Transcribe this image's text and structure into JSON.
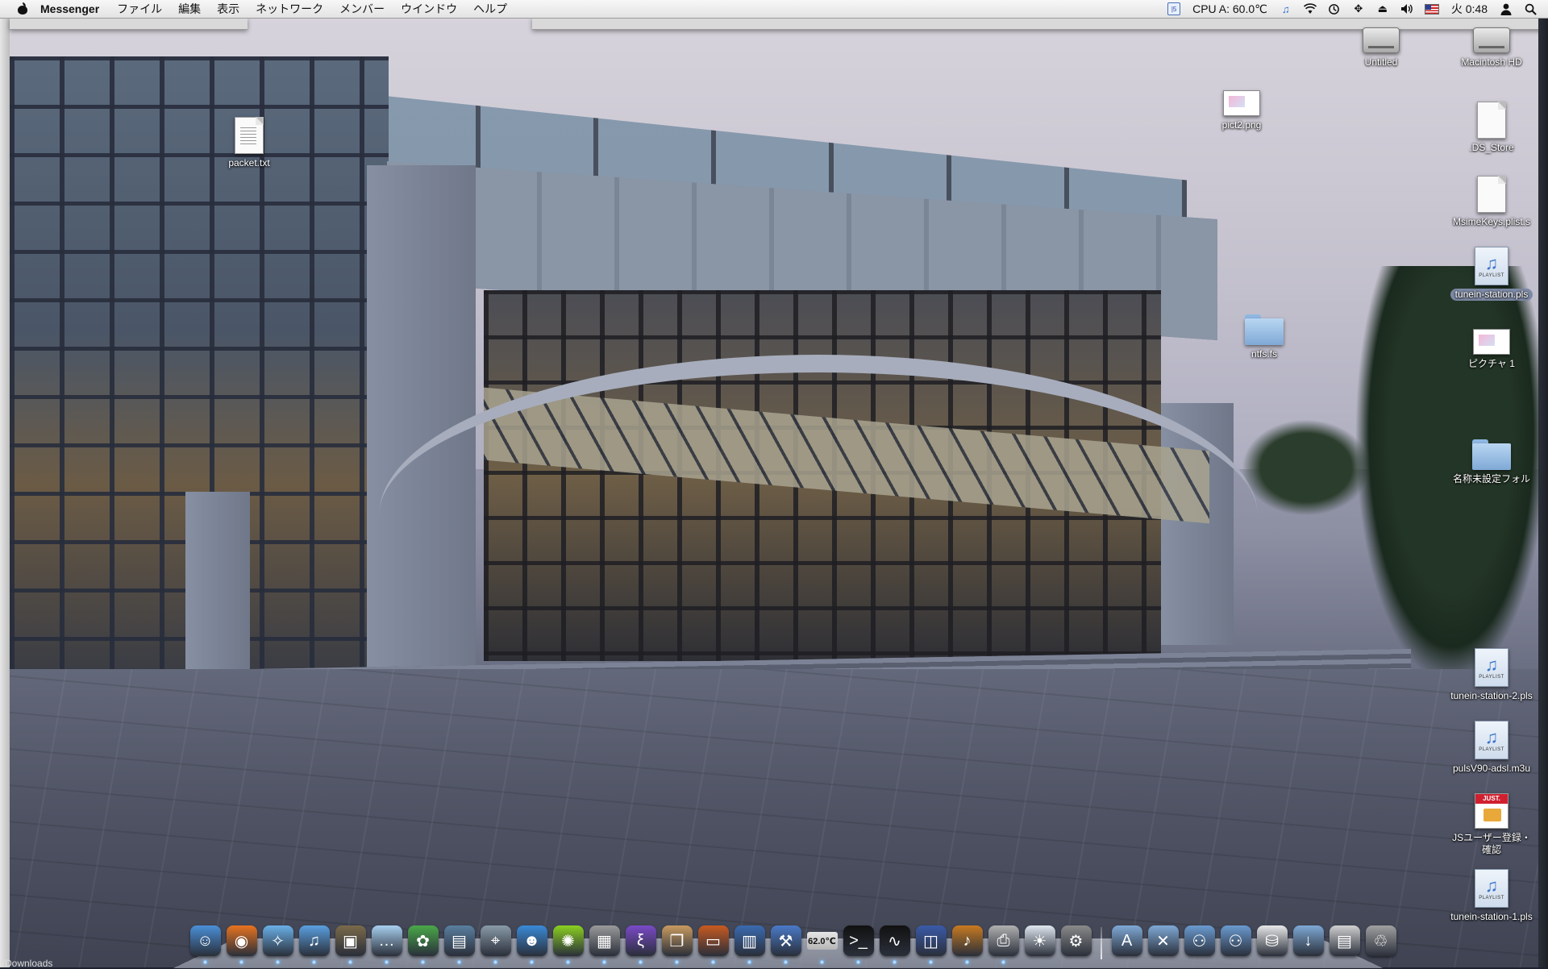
{
  "menubar": {
    "app_name": "Messenger",
    "menus": [
      "ファイル",
      "編集",
      "表示",
      "ネットワーク",
      "メンバー",
      "ウインドウ",
      "ヘルプ"
    ],
    "cpu_text": "CPU A: 60.0℃",
    "clock": "火 0:48"
  },
  "desktop": {
    "icons": [
      {
        "label": "packet.txt",
        "type": "text-document"
      },
      {
        "label": "Untitled",
        "type": "disk"
      },
      {
        "label": "Macintosh HD",
        "type": "disk"
      },
      {
        "label": "pict2.png",
        "type": "image"
      },
      {
        "label": ".DS_Store",
        "type": "document"
      },
      {
        "label": "MsimeKeys.plist.s",
        "type": "document"
      },
      {
        "label": "tunein-station.pls",
        "type": "playlist",
        "selected": true
      },
      {
        "label": "ntfs.fs",
        "type": "folder"
      },
      {
        "label": "ピクチャ 1",
        "type": "image"
      },
      {
        "label": "名称未設定フォル",
        "type": "folder"
      },
      {
        "label": "tunein-station-2.pls",
        "type": "playlist"
      },
      {
        "label": "pulsV90-adsl.m3u",
        "type": "playlist"
      },
      {
        "label": "JSユーザー登録・確認",
        "type": "js-document"
      },
      {
        "label": "tunein-station-1.pls",
        "type": "playlist"
      }
    ],
    "playlist_badge": "PLAYLIST",
    "path_fragment": "l/Downloads"
  },
  "dock": {
    "temperature": "62.0℃",
    "apps": [
      {
        "icon": "finder-icon",
        "color": "#4a8fd8"
      },
      {
        "icon": "firefox-icon",
        "color": "#e8731f"
      },
      {
        "icon": "safari-icon",
        "color": "#6ab0e8"
      },
      {
        "icon": "itunes-icon",
        "color": "#5a9fe0"
      },
      {
        "icon": "iphoto-icon",
        "color": "#7a6a4a"
      },
      {
        "icon": "messages-icon",
        "color": "#a8d0f0"
      },
      {
        "icon": "plant-icon",
        "color": "#4aa84a"
      },
      {
        "icon": "network-monitor-icon",
        "color": "#5a7fa0"
      },
      {
        "icon": "satellite-icon",
        "color": "#8a9aa8"
      },
      {
        "icon": "buddy-icon",
        "color": "#3a8ad8"
      },
      {
        "icon": "lime-icon",
        "color": "#8ad020"
      },
      {
        "icon": "calculator-icon",
        "color": "#9a9a9a"
      },
      {
        "icon": "emacs-icon",
        "color": "#7a4ac8"
      },
      {
        "icon": "preview-icon",
        "color": "#c89a60"
      },
      {
        "icon": "keynote-icon",
        "color": "#c85a20"
      },
      {
        "icon": "activity-chart-icon",
        "color": "#3a6ab0"
      },
      {
        "icon": "xcode-icon",
        "color": "#4a7ac8"
      },
      {
        "icon": "temperature-monitor-icon",
        "color": "#c0c0c0"
      },
      {
        "icon": "terminal-icon",
        "color": "#111111"
      },
      {
        "icon": "activity-monitor-icon",
        "color": "#111111"
      },
      {
        "icon": "virtualbox-icon",
        "color": "#3a5aa8"
      },
      {
        "icon": "garageband-icon",
        "color": "#c87a20"
      },
      {
        "icon": "printer-icon",
        "color": "#b0b0b0"
      },
      {
        "icon": "lightbulb-icon",
        "color": "#e0e8f0"
      },
      {
        "icon": "system-preferences-icon",
        "color": "#8a8a8a"
      }
    ],
    "stacks": [
      {
        "icon": "applications-folder-icon",
        "color": "#7fa9d6"
      },
      {
        "icon": "utilities-folder-icon",
        "color": "#7fa9d6"
      },
      {
        "icon": "network-users-icon",
        "color": "#6a9ad0"
      },
      {
        "icon": "network-users-2-icon",
        "color": "#6a9ad0"
      },
      {
        "icon": "zip-archive-icon",
        "color": "#e8e8e8"
      },
      {
        "icon": "downloads-folder-icon",
        "color": "#7fa9d6"
      },
      {
        "icon": "document-stack-icon",
        "color": "#d0d0d0"
      },
      {
        "icon": "trash-icon",
        "color": "#a0a0a0"
      }
    ]
  }
}
